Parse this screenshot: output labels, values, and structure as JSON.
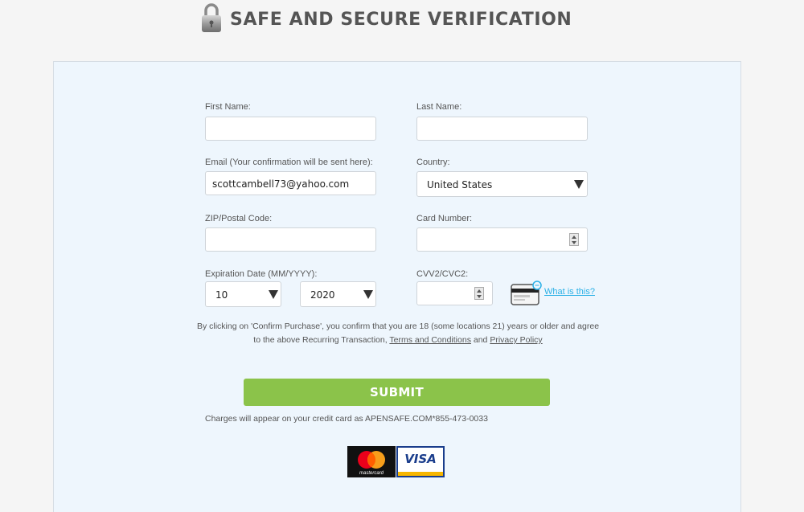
{
  "header": {
    "title": "SAFE AND SECURE VERIFICATION",
    "icon": "lock-icon"
  },
  "form": {
    "first_name": {
      "label": "First Name:",
      "value": ""
    },
    "last_name": {
      "label": "Last Name:",
      "value": ""
    },
    "email": {
      "label": "Email (Your confirmation will be sent here):",
      "value": "scottcambell73@yahoo.com"
    },
    "country": {
      "label": "Country:",
      "value": "United States"
    },
    "zip": {
      "label": "ZIP/Postal Code:",
      "value": ""
    },
    "card_number": {
      "label": "Card Number:",
      "value": ""
    },
    "expiration": {
      "label": "Expiration Date (MM/YYYY):",
      "month": "10",
      "year": "2020"
    },
    "cvv": {
      "label": "CVV2/CVC2:",
      "value": "",
      "help_link": "What is this?"
    }
  },
  "consent": {
    "text_before": "By clicking on 'Confirm Purchase', you confirm that you are 18 (some locations 21) years or older and agree to the above Recurring Transaction,",
    "terms_link": "Terms and Conditions",
    "and_text": "and",
    "privacy_link": "Privacy Policy"
  },
  "submit_label": "SUBMIT",
  "charges_note": "Charges will appear on your credit card as APENSAFE.COM*855-473-0033",
  "payment_logos": {
    "mastercard_label": "mastercard",
    "visa_label": "VISA"
  },
  "colors": {
    "accent": "#8bc34a",
    "link": "#2ab0e6",
    "panel_bg": "#eef6fd",
    "title": "#555555"
  }
}
